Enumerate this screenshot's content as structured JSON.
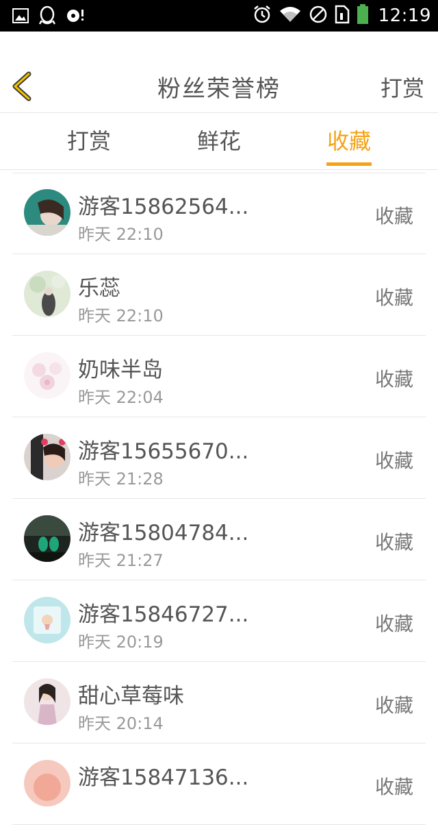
{
  "status_bar": {
    "time": "12:19",
    "left_icons": [
      "image-icon",
      "qq-icon",
      "music-icon"
    ],
    "right_icons": [
      "alarm-icon",
      "wifi-icon",
      "no-sim-icon",
      "sim-card-icon",
      "battery-icon"
    ]
  },
  "header": {
    "title": "粉丝荣誉榜",
    "action": "打赏",
    "accent": "#f5a214"
  },
  "tabs": [
    {
      "label": "打赏",
      "active": false
    },
    {
      "label": "鲜花",
      "active": false
    },
    {
      "label": "收藏",
      "active": true
    }
  ],
  "list": [
    {
      "name": "游客15862564...",
      "time": "昨天 22:10",
      "action": "收藏"
    },
    {
      "name": "乐蕊",
      "time": "昨天 22:10",
      "action": "收藏"
    },
    {
      "name": "奶味半岛",
      "time": "昨天 22:04",
      "action": "收藏"
    },
    {
      "name": "游客15655670...",
      "time": "昨天 21:28",
      "action": "收藏"
    },
    {
      "name": "游客15804784...",
      "time": "昨天 21:27",
      "action": "收藏"
    },
    {
      "name": "游客15846727...",
      "time": "昨天 20:19",
      "action": "收藏"
    },
    {
      "name": "甜心草莓味",
      "time": "昨天 20:14",
      "action": "收藏"
    },
    {
      "name": "游客15847136...",
      "time": "",
      "action": "收藏"
    }
  ]
}
